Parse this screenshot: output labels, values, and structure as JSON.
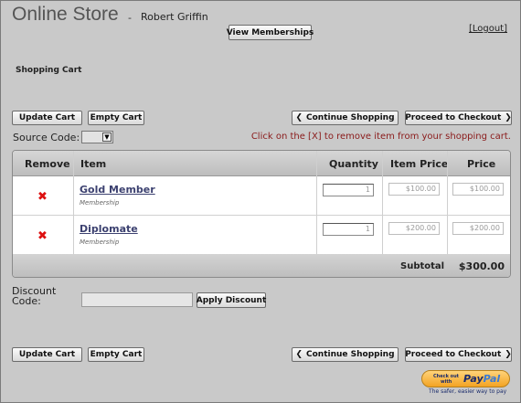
{
  "header": {
    "store_title": "Online Store",
    "separator": "-",
    "user_name": "Robert Griffin",
    "view_memberships_label": "View Memberships",
    "logout_label": "[Logout]"
  },
  "cart_heading": "Shopping Cart",
  "actions": {
    "update_cart": "Update Cart",
    "empty_cart": "Empty Cart",
    "continue_shopping": "Continue Shopping",
    "proceed_to_checkout": "Proceed to Checkout",
    "apply_discount": "Apply Discount"
  },
  "source_code": {
    "label": "Source Code:",
    "selected": ""
  },
  "remove_hint": "Click on the [X] to remove item from your shopping cart.",
  "table": {
    "headers": {
      "remove": "Remove",
      "item": "Item",
      "quantity": "Quantity",
      "item_price": "Item Price",
      "price": "Price"
    },
    "rows": [
      {
        "name": "Gold Member",
        "type": "Membership",
        "quantity": "1",
        "item_price": "$100.00",
        "price": "$100.00"
      },
      {
        "name": "Diplomate",
        "type": "Membership",
        "quantity": "1",
        "item_price": "$200.00",
        "price": "$200.00"
      }
    ],
    "subtotal_label": "Subtotal",
    "subtotal_value": "$300.00"
  },
  "discount": {
    "label_line1": "Discount",
    "label_line2": "Code:",
    "value": ""
  },
  "paypal": {
    "small_text_1": "Check out",
    "small_text_2": "with",
    "logo_pay": "Pay",
    "logo_pal": "Pal",
    "tagline": "The safer, easier way to pay"
  },
  "icons": {
    "remove": "remove-x-icon",
    "chevron_left": "chevron-left-icon",
    "chevron_right": "chevron-right-icon",
    "dropdown": "chevron-down-icon"
  },
  "colors": {
    "background": "#c9c9c9",
    "remove_x": "#dd1111",
    "hint_text": "#8a1a1a",
    "link": "#3c4170",
    "paypal_gold": "#f3a323"
  }
}
